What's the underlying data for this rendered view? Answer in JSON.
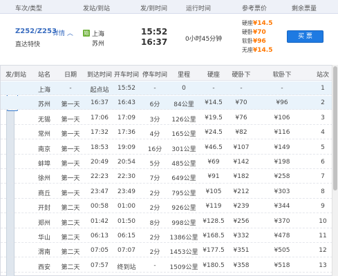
{
  "header": {
    "col_train": "车次/类型",
    "col_stations": "发站/到站",
    "col_times": "发/到时间",
    "col_duration": "运行时间",
    "col_price": "参考票价",
    "col_remaining": "剩余票量"
  },
  "train": {
    "code": "Z252/Z253",
    "detail_link": "详情",
    "type": "直达特快",
    "from_badge": "始",
    "from_station": "上海",
    "to_station": "苏州",
    "depart_time": "15:52",
    "arrive_time": "16:37",
    "duration": "0小时45分钟",
    "prices": [
      {
        "label": "硬座",
        "value": "¥14.5"
      },
      {
        "label": "硬卧",
        "value": "¥70"
      },
      {
        "label": "软卧",
        "value": "¥96"
      },
      {
        "label": "无座",
        "value": "¥14.5"
      }
    ],
    "buy_label": "买 票"
  },
  "stops_table": {
    "headers": [
      "发/到站",
      "站名",
      "日期",
      "到达时间",
      "开车时间",
      "停车时间",
      "里程",
      "硬座",
      "硬卧下",
      "软卧下",
      "站次"
    ],
    "tag_depart": "发",
    "tag_arrive": "到",
    "rows": [
      {
        "station": "上海",
        "day": "-",
        "arrive": "起点站",
        "depart": "15:52",
        "stop": "-",
        "distance": "0",
        "hard_seat": "-",
        "hard_sleeper": "-",
        "soft_sleeper": "-",
        "no": "1"
      },
      {
        "station": "苏州",
        "day": "第一天",
        "arrive": "16:37",
        "depart": "16:43",
        "stop": "6分",
        "distance": "84公里",
        "hard_seat": "¥14.5",
        "hard_sleeper": "¥70",
        "soft_sleeper": "¥96",
        "no": "2"
      },
      {
        "station": "无锡",
        "day": "第一天",
        "arrive": "17:06",
        "depart": "17:09",
        "stop": "3分",
        "distance": "126公里",
        "hard_seat": "¥19.5",
        "hard_sleeper": "¥76",
        "soft_sleeper": "¥106",
        "no": "3"
      },
      {
        "station": "常州",
        "day": "第一天",
        "arrive": "17:32",
        "depart": "17:36",
        "stop": "4分",
        "distance": "165公里",
        "hard_seat": "¥24.5",
        "hard_sleeper": "¥82",
        "soft_sleeper": "¥116",
        "no": "4"
      },
      {
        "station": "南京",
        "day": "第一天",
        "arrive": "18:53",
        "depart": "19:09",
        "stop": "16分",
        "distance": "301公里",
        "hard_seat": "¥46.5",
        "hard_sleeper": "¥107",
        "soft_sleeper": "¥149",
        "no": "5"
      },
      {
        "station": "蚌埠",
        "day": "第一天",
        "arrive": "20:49",
        "depart": "20:54",
        "stop": "5分",
        "distance": "485公里",
        "hard_seat": "¥69",
        "hard_sleeper": "¥142",
        "soft_sleeper": "¥198",
        "no": "6"
      },
      {
        "station": "徐州",
        "day": "第一天",
        "arrive": "22:23",
        "depart": "22:30",
        "stop": "7分",
        "distance": "649公里",
        "hard_seat": "¥91",
        "hard_sleeper": "¥182",
        "soft_sleeper": "¥258",
        "no": "7"
      },
      {
        "station": "商丘",
        "day": "第一天",
        "arrive": "23:47",
        "depart": "23:49",
        "stop": "2分",
        "distance": "795公里",
        "hard_seat": "¥105",
        "hard_sleeper": "¥212",
        "soft_sleeper": "¥303",
        "no": "8"
      },
      {
        "station": "开封",
        "day": "第二天",
        "arrive": "00:58",
        "depart": "01:00",
        "stop": "2分",
        "distance": "926公里",
        "hard_seat": "¥119",
        "hard_sleeper": "¥239",
        "soft_sleeper": "¥344",
        "no": "9"
      },
      {
        "station": "郑州",
        "day": "第二天",
        "arrive": "01:42",
        "depart": "01:50",
        "stop": "8分",
        "distance": "998公里",
        "hard_seat": "¥128.5",
        "hard_sleeper": "¥256",
        "soft_sleeper": "¥370",
        "no": "10"
      },
      {
        "station": "华山",
        "day": "第二天",
        "arrive": "06:13",
        "depart": "06:15",
        "stop": "2分",
        "distance": "1386公里",
        "hard_seat": "¥168.5",
        "hard_sleeper": "¥332",
        "soft_sleeper": "¥478",
        "no": "11"
      },
      {
        "station": "渭南",
        "day": "第二天",
        "arrive": "07:05",
        "depart": "07:07",
        "stop": "2分",
        "distance": "1453公里",
        "hard_seat": "¥177.5",
        "hard_sleeper": "¥351",
        "soft_sleeper": "¥505",
        "no": "12"
      },
      {
        "station": "西安",
        "day": "第二天",
        "arrive": "07:57",
        "depart": "终到站",
        "stop": "-",
        "distance": "1509公里",
        "hard_seat": "¥180.5",
        "hard_sleeper": "¥358",
        "soft_sleeper": "¥518",
        "no": "13"
      }
    ]
  },
  "colors": {
    "link_blue": "#3a6dc0",
    "price_orange": "#ff7700",
    "button_blue": "#1e7ae2",
    "highlight_row": "#e9f3fb",
    "start_badge_green": "#6fb13a"
  }
}
